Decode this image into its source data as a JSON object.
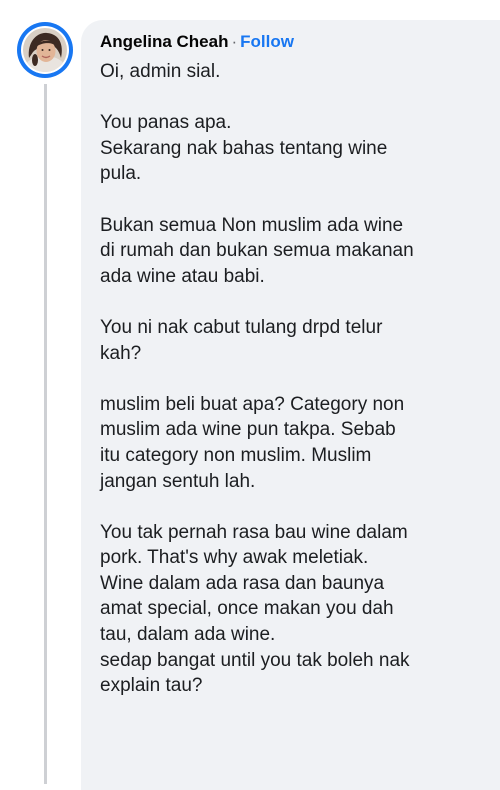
{
  "comment": {
    "author": "Angelina Cheah",
    "separator": "·",
    "follow_label": "Follow",
    "paragraphs": [
      [
        "Oi, admin sial."
      ],
      [
        "You panas apa.",
        "Sekarang nak bahas tentang wine",
        "pula."
      ],
      [
        "Bukan semua Non muslim ada wine",
        "di rumah dan bukan semua makanan",
        "ada wine atau babi."
      ],
      [
        "You ni nak cabut tulang drpd telur",
        "kah?"
      ],
      [
        "muslim beli buat apa? Category non",
        "muslim ada wine pun takpa. Sebab",
        "itu category non muslim. Muslim",
        "jangan sentuh lah."
      ],
      [
        "You tak pernah rasa bau wine dalam",
        "pork. That's why awak meletiak.",
        "Wine dalam ada rasa dan baunya",
        "amat special, once makan you dah",
        "tau, dalam ada wine.",
        "sedap bangat until you tak boleh nak",
        "explain tau?"
      ]
    ]
  },
  "colors": {
    "accent": "#1877f2",
    "bubble_bg": "#f0f2f5",
    "text": "#1c1e21",
    "thread_line": "#ced0d4"
  },
  "icons": {
    "avatar": "profile-photo"
  }
}
